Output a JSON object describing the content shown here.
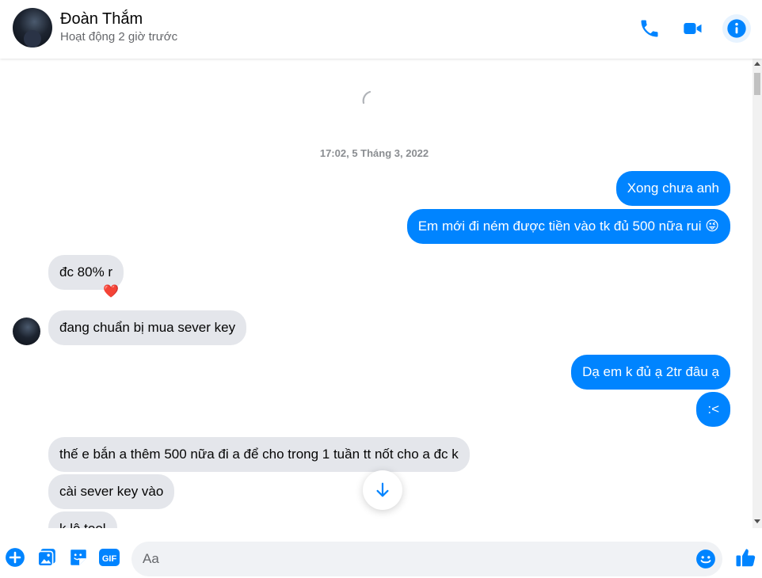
{
  "header": {
    "name": "Đoàn Thắm",
    "status": "Hoạt động 2 giờ trước",
    "accent": "#0084ff"
  },
  "chat": {
    "timestamp": "17:02, 5 Tháng 3, 2022",
    "messages": [
      {
        "side": "out",
        "text": "Xong chưa anh"
      },
      {
        "side": "out",
        "text": "Em mới đi ném được tiền vào tk đủ 500 nữa rui 😜"
      },
      {
        "side": "in",
        "text": "đc 80% r",
        "reaction": "❤️"
      },
      {
        "side": "in",
        "text": "đang chuẩn bị mua sever key"
      },
      {
        "side": "out",
        "text": "Dạ em k đủ ạ 2tr đâu ạ"
      },
      {
        "side": "out",
        "text": ":<"
      },
      {
        "side": "in",
        "text": "thế e bắn a thêm 500 nữa đi a để cho trong 1 tuần tt nốt cho a đc k"
      },
      {
        "side": "in",
        "text": "cài sever key vào"
      },
      {
        "side": "in",
        "text": "k lộ tool"
      }
    ]
  },
  "composer": {
    "placeholder": "Aa",
    "gif_label": "GIF"
  },
  "icons": {
    "call": "phone-icon",
    "video": "video-icon",
    "info": "info-icon",
    "add": "plus-icon",
    "photo": "image-icon",
    "sticker": "sticker-icon",
    "gif": "gif-icon",
    "emoji": "emoji-icon",
    "like": "thumbs-up-icon",
    "scroll": "arrow-down-icon"
  }
}
